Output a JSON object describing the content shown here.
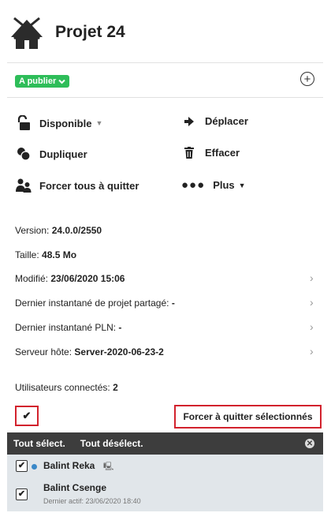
{
  "header": {
    "title": "Projet 24"
  },
  "status_pill": {
    "label": "A publier"
  },
  "actions": {
    "available": "Disponible",
    "move": "Déplacer",
    "duplicate": "Dupliquer",
    "delete": "Effacer",
    "force_all": "Forcer tous à quitter",
    "more": "Plus"
  },
  "info": {
    "version_label": "Version:",
    "version_value": "24.0.0/2550",
    "size_label": "Taille:",
    "size_value": "48.5 Mo",
    "modified_label": "Modifié:",
    "modified_value": "23/06/2020 15:06",
    "snapshot_shared_label": "Dernier instantané de projet partagé:",
    "snapshot_shared_value": "-",
    "snapshot_pln_label": "Dernier instantané PLN:",
    "snapshot_pln_value": "-",
    "server_label": "Serveur hôte:",
    "server_value": "Server-2020-06-23-2"
  },
  "users": {
    "connected_label": "Utilisateurs connectés:",
    "connected_count": "2",
    "force_selected": "Forcer à quitter sélectionnés",
    "select_all": "Tout sélect.",
    "deselect_all": "Tout désélect.",
    "list": [
      {
        "name": "Balint Reka",
        "online": true
      },
      {
        "name": "Balint Csenge",
        "last_active": "Dernier actif: 23/06/2020 18:40"
      }
    ]
  },
  "colors": {
    "pill": "#2ebd59",
    "highlight": "#d2222d",
    "bar": "#3d3d3d",
    "row": "#e1e6ea",
    "online": "#3a88c8"
  }
}
